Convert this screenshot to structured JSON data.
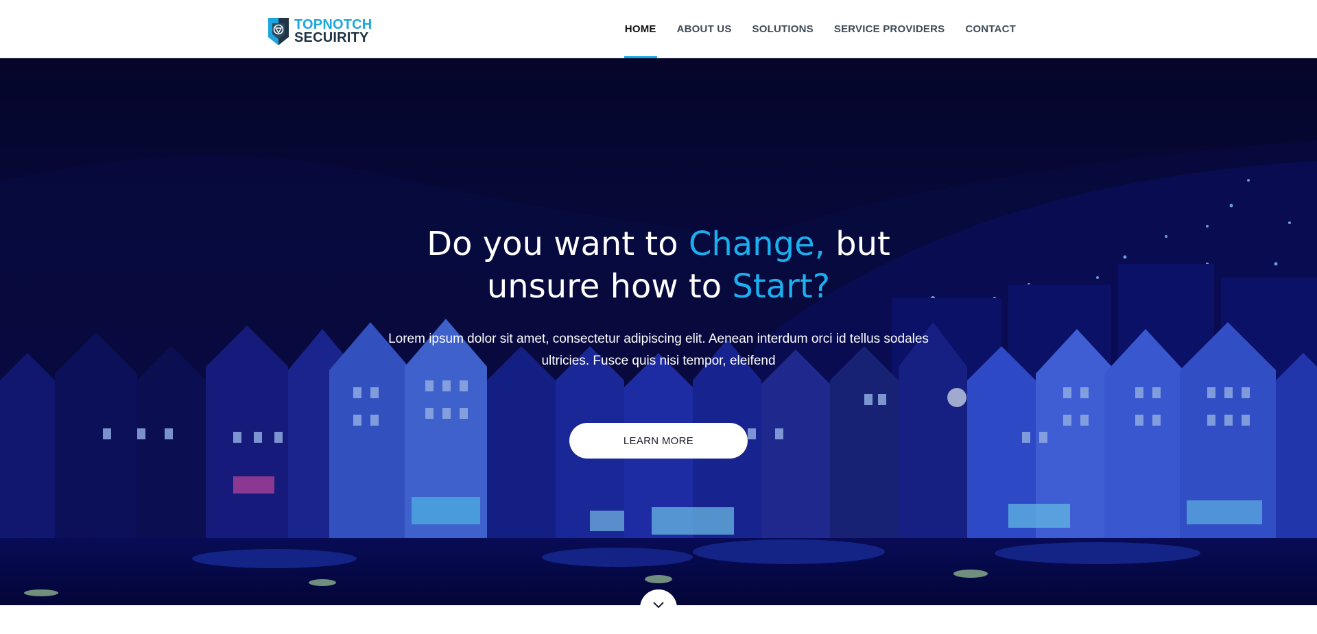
{
  "brand": {
    "line1": "TOPNOTCH",
    "line2": "SECUIRITY",
    "logo_icon": "shield-icon",
    "colors": {
      "accent": "#1aa7e0",
      "dark": "#1f3344"
    }
  },
  "nav": {
    "items": [
      {
        "label": "HOME",
        "active": true
      },
      {
        "label": "ABOUT US",
        "active": false
      },
      {
        "label": "SOLUTIONS",
        "active": false
      },
      {
        "label": "SERVICE PROVIDERS",
        "active": false
      },
      {
        "label": "CONTACT",
        "active": false
      }
    ]
  },
  "hero": {
    "headline": {
      "part1": "Do you want to ",
      "accent1": "Change,",
      "part2": " but",
      "part3": "unsure how to ",
      "accent2": "Start?"
    },
    "subtext": "Lorem ipsum dolor sit amet, consectetur adipiscing elit. Aenean interdum orci id tellus sodales ultricies. Fusce quis nisi tempor, eleifend",
    "cta_label": "LEARN MORE",
    "accent_color": "#1ab0ef",
    "scroll_icon": "chevron-down-icon"
  }
}
